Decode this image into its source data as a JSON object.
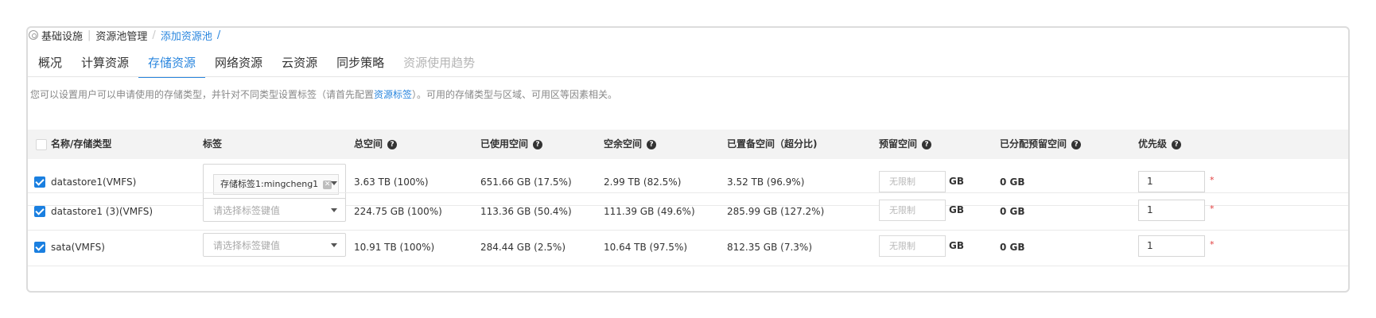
{
  "breadcrumb": {
    "items": [
      "基础设施",
      "资源池管理",
      "添加资源池"
    ],
    "trailing": "/"
  },
  "tabs": [
    {
      "label": "概况",
      "state": "normal"
    },
    {
      "label": "计算资源",
      "state": "normal"
    },
    {
      "label": "存储资源",
      "state": "active"
    },
    {
      "label": "网络资源",
      "state": "normal"
    },
    {
      "label": "云资源",
      "state": "normal"
    },
    {
      "label": "同步策略",
      "state": "normal"
    },
    {
      "label": "资源使用趋势",
      "state": "disabled"
    }
  ],
  "description": {
    "before": "您可以设置用户可以申请使用的存储类型，并针对不同类型设置标签（请首先配置",
    "link": "资源标签",
    "after": "）。可用的存储类型与区域、可用区等因素相关。"
  },
  "table": {
    "headers": {
      "name": "名称/存储类型",
      "tag": "标签",
      "total": "总空间",
      "used": "已使用空间",
      "free": "空余空间",
      "provisioned": "已置备空间（超分比)",
      "reserved": "预留空间",
      "allocated": "已分配预留空间",
      "priority": "优先级"
    },
    "tag_placeholder": "请选择标签键值",
    "reserve_placeholder": "无限制",
    "unit": "GB",
    "required_mark": "*",
    "rows": [
      {
        "checked": true,
        "name": "datastore1(VMFS)",
        "tag": "存储标签1:mingcheng1",
        "total": "3.63 TB (100%)",
        "used": "651.66 GB (17.5%)",
        "free": "2.99 TB (82.5%)",
        "provisioned": "3.52 TB (96.9%)",
        "allocated": "0 GB",
        "priority": "1"
      },
      {
        "checked": true,
        "name": "datastore1 (3)(VMFS)",
        "tag": "",
        "total": "224.75 GB (100%)",
        "used": "113.36 GB (50.4%)",
        "free": "111.39 GB (49.6%)",
        "provisioned": "285.99 GB (127.2%)",
        "allocated": "0 GB",
        "priority": "1"
      },
      {
        "checked": true,
        "name": "sata(VMFS)",
        "tag": "",
        "total": "10.91 TB (100%)",
        "used": "284.44 GB (2.5%)",
        "free": "10.64 TB (97.5%)",
        "provisioned": "812.35 GB (7.3%)",
        "allocated": "0 GB",
        "priority": "1"
      }
    ]
  },
  "colors": {
    "accent": "#2a86de",
    "checkbox": "#1a7fe0",
    "required": "#e23c3c"
  }
}
